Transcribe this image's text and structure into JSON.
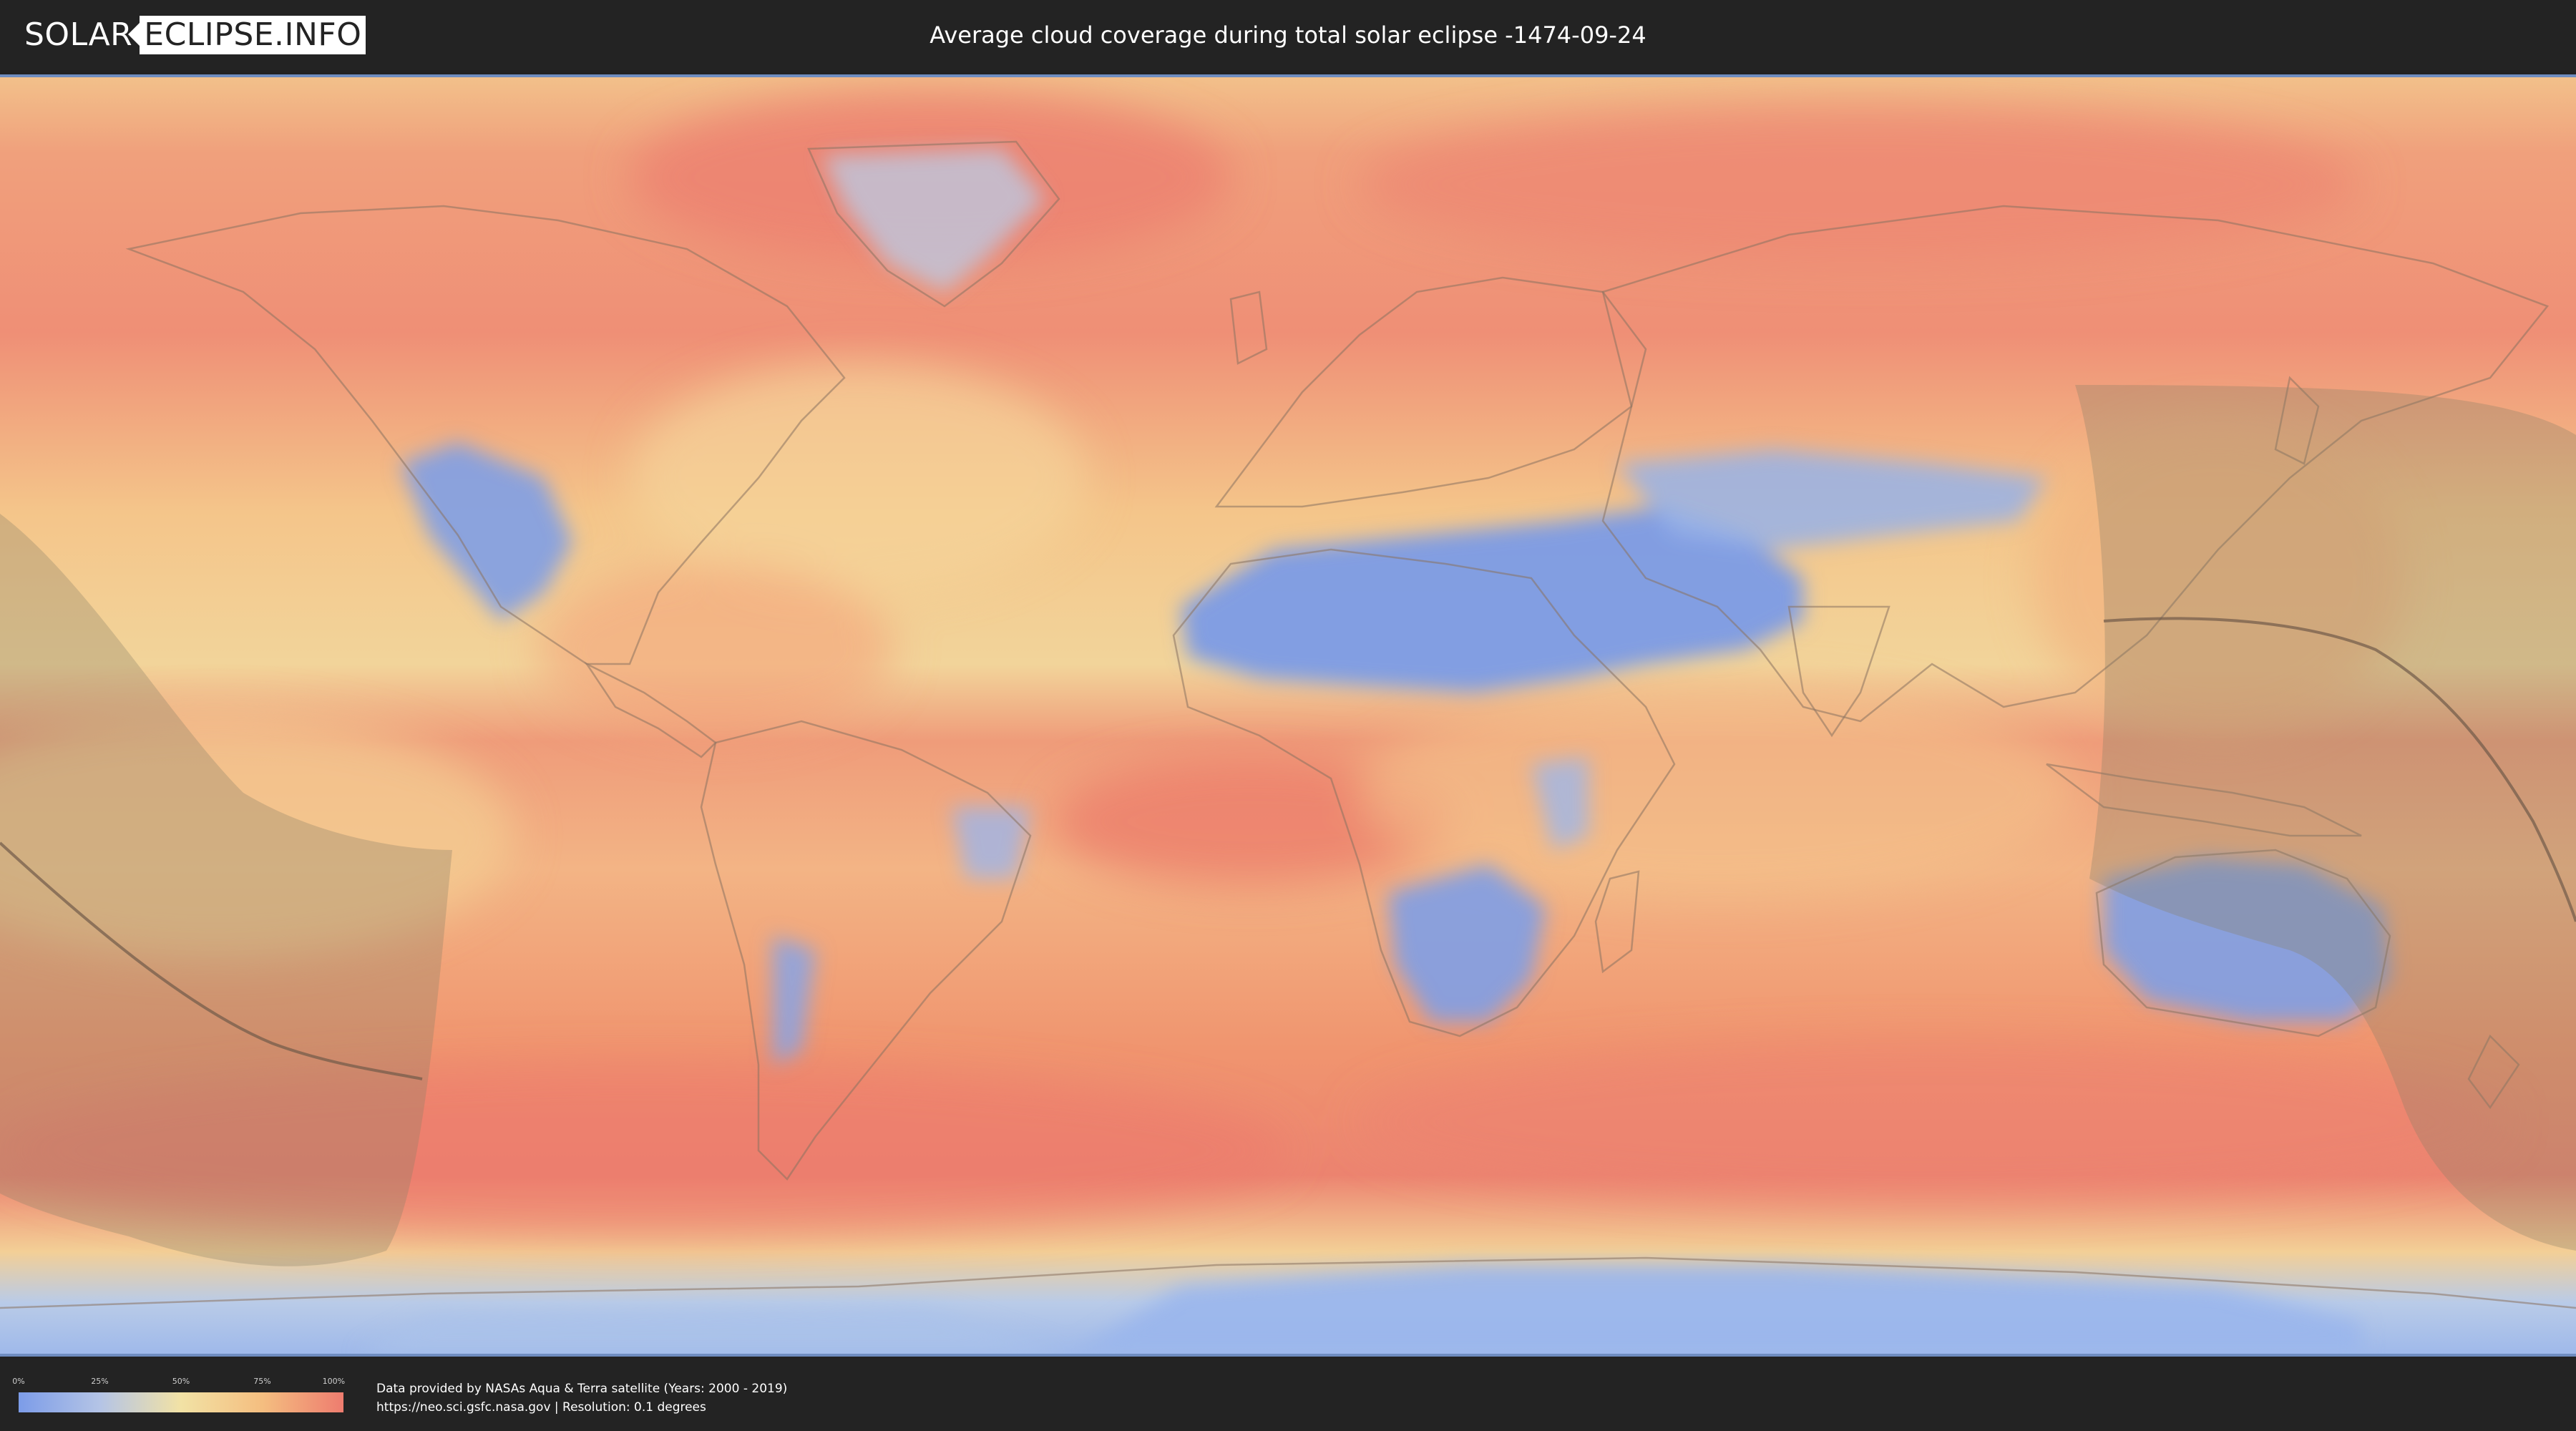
{
  "header": {
    "logo_left": "SOLAR",
    "logo_right": "ECLIPSE.INFO",
    "title": "Average cloud coverage during total solar eclipse -1474-09-24"
  },
  "map": {
    "type": "world cloud coverage map",
    "colors": {
      "clear": "#7c9ce8",
      "low": "#b4c4e6",
      "mid": "#f2e2a5",
      "high": "#f4be80",
      "overcast": "#ee7c6f",
      "eclipse_shadow": "#8a8068",
      "central_line": "#6f5a4a",
      "border": "#6f8dc0"
    }
  },
  "legend": {
    "ticks": [
      "0%",
      "25%",
      "50%",
      "75%",
      "100%"
    ],
    "tick_values": [
      0,
      25,
      50,
      75,
      100
    ]
  },
  "credits": {
    "line1": "Data provided by NASAs Aqua & Terra satellite (Years: 2000 - 2019)",
    "line2": "https://neo.sci.gsfc.nasa.gov | Resolution: 0.1 degrees"
  }
}
